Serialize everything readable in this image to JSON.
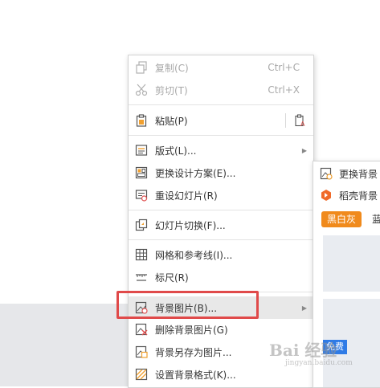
{
  "menu": {
    "items": [
      {
        "label": "复制(C)",
        "shortcut": "Ctrl+C",
        "icon": "copy-icon",
        "disabled": true
      },
      {
        "label": "剪切(T)",
        "shortcut": "Ctrl+X",
        "icon": "cut-icon",
        "disabled": true
      },
      {
        "label": "粘贴(P)",
        "icon": "paste-icon",
        "extra_icon": "paste-text-icon"
      },
      {
        "label": "版式(L)...",
        "icon": "layout-icon",
        "submenu": true
      },
      {
        "label": "更换设计方案(E)...",
        "icon": "design-icon"
      },
      {
        "label": "重设幻灯片(R)",
        "icon": "reset-slide-icon"
      },
      {
        "label": "幻灯片切换(F)...",
        "icon": "transition-icon"
      },
      {
        "label": "网格和参考线(I)...",
        "icon": "grid-icon"
      },
      {
        "label": "标尺(R)",
        "icon": "ruler-icon"
      },
      {
        "label": "背景图片(B)...",
        "icon": "background-image-icon",
        "submenu": true,
        "highlighted": true
      },
      {
        "label": "删除背景图片(G)",
        "icon": "delete-background-icon"
      },
      {
        "label": "背景另存为图片...",
        "icon": "save-background-icon"
      },
      {
        "label": "设置背景格式(K)...",
        "icon": "background-format-icon"
      }
    ]
  },
  "submenu": {
    "replace_label": "更换背景",
    "docer_label": "稻壳背景",
    "chip_active": "黑白灰",
    "chip_next": "蓝",
    "free_badge": "免费"
  },
  "watermark": {
    "text": "Bai 经验",
    "sub": "jingyan.baidu.com"
  },
  "colors": {
    "highlight": "#e04a4a",
    "chip": "#f08a1c",
    "free": "#2f7be6"
  }
}
